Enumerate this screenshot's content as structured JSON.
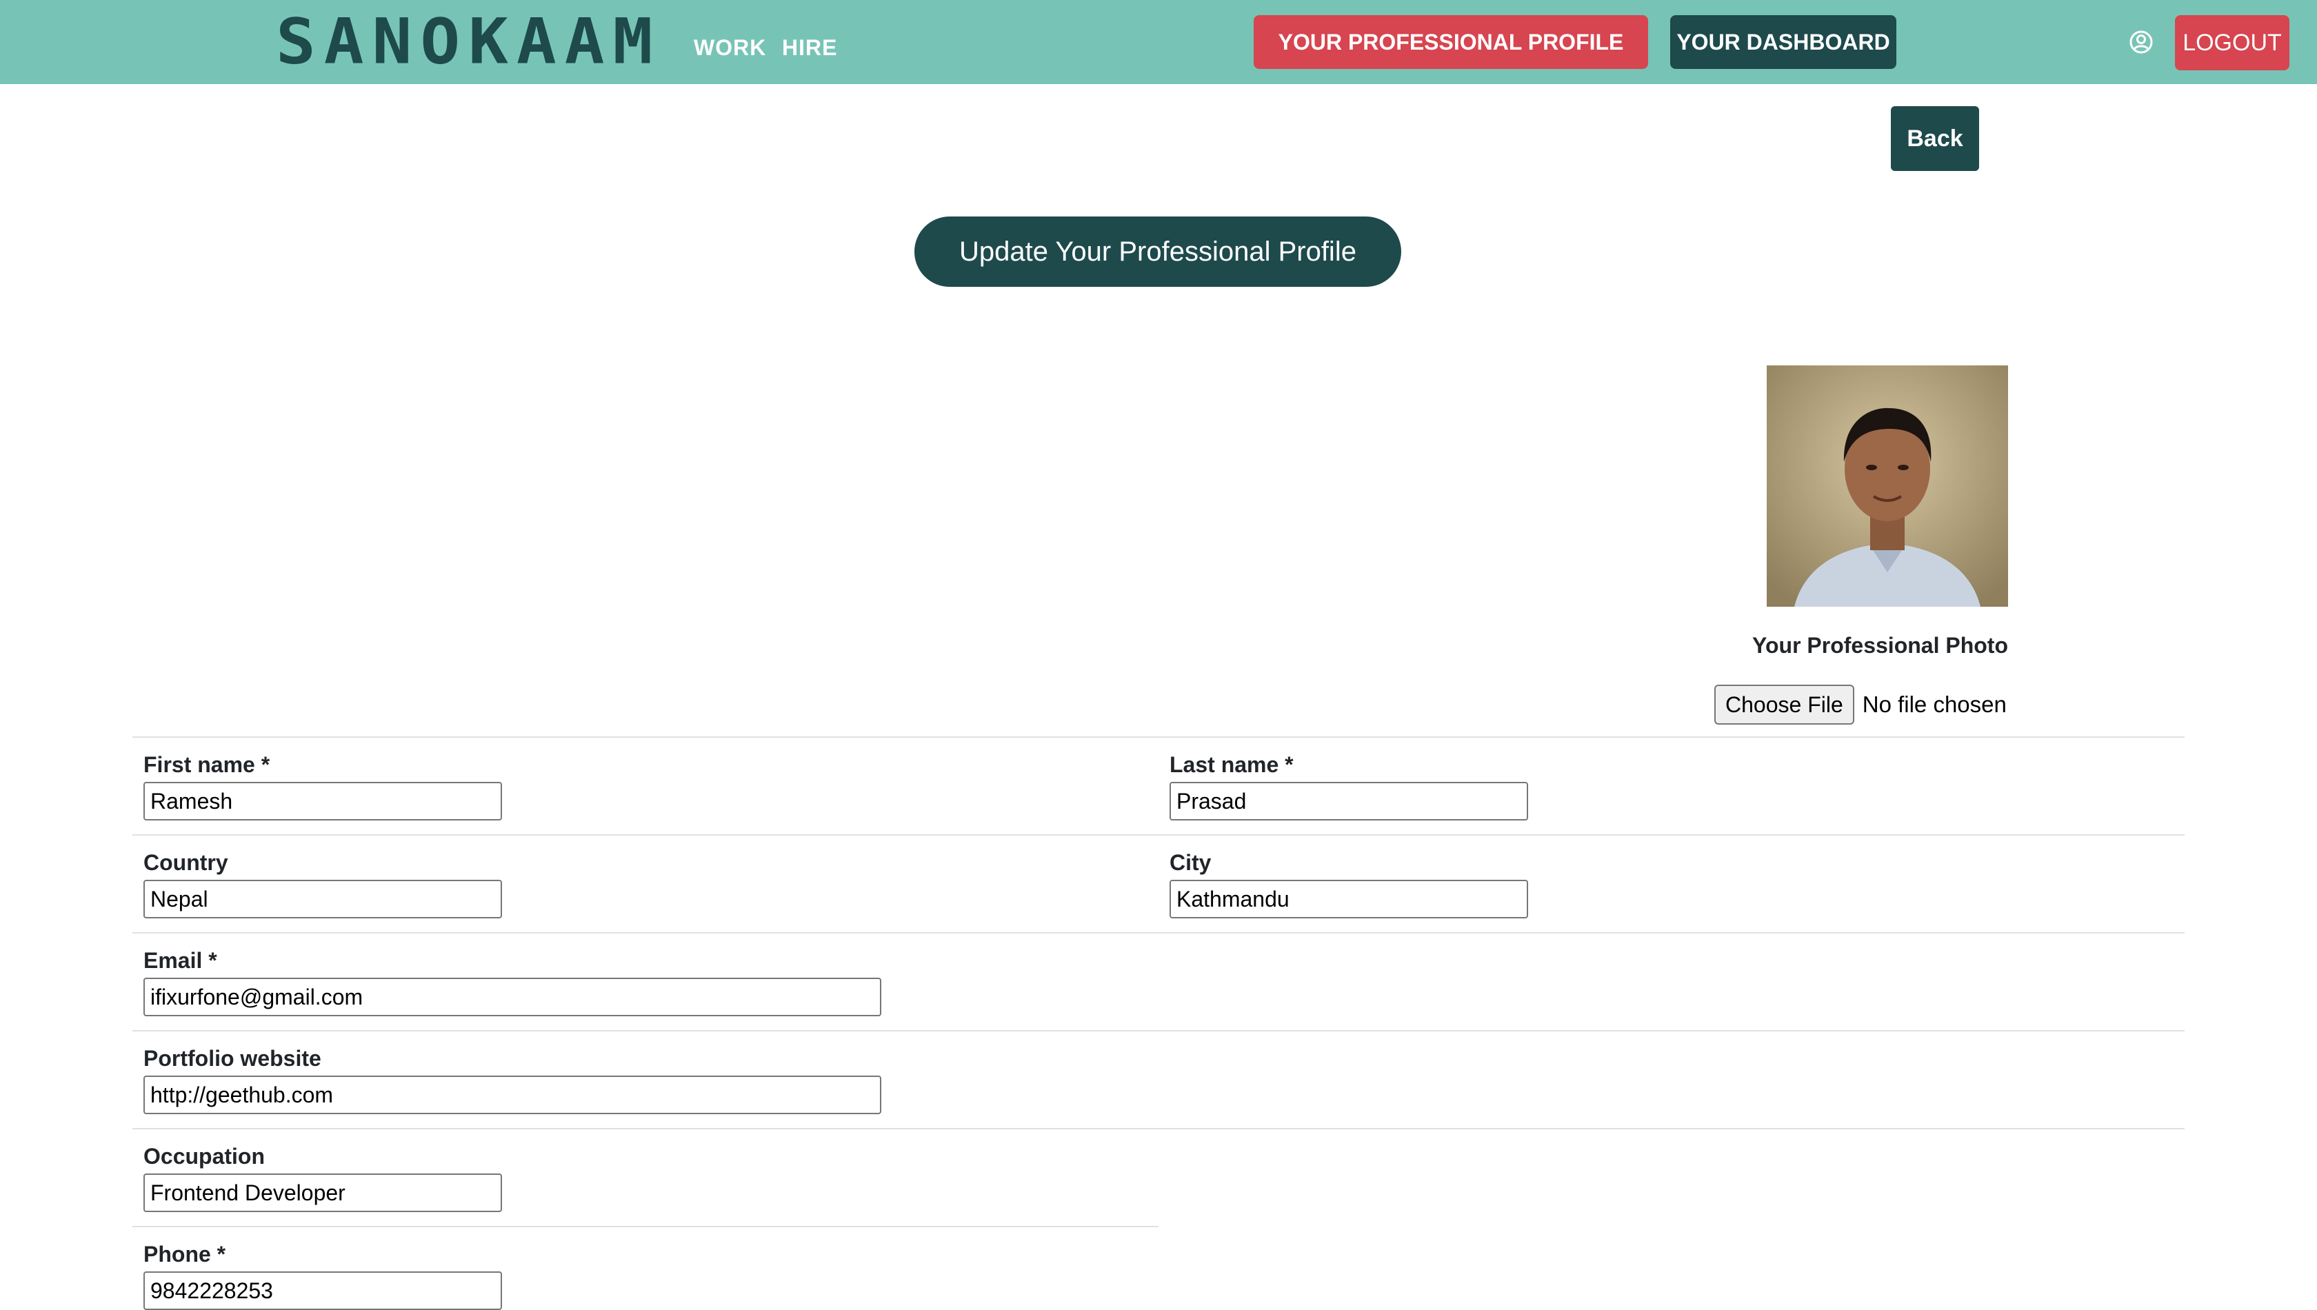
{
  "navbar": {
    "brand": "SANOKAAM",
    "links": [
      "WORK",
      "HIRE"
    ],
    "profile_button": "YOUR PROFESSIONAL PROFILE",
    "dashboard_button": "YOUR DASHBOARD",
    "logout_button": "LOGOUT",
    "user_icon": "user-circle-icon"
  },
  "page": {
    "back_button": "Back",
    "update_button": "Update Your Professional Profile"
  },
  "photo": {
    "caption": "Your Professional Photo",
    "choose_file": "Choose File",
    "file_status": "No file chosen"
  },
  "form": {
    "first_name": {
      "label": "First name *",
      "value": "Ramesh"
    },
    "last_name": {
      "label": "Last name *",
      "value": "Prasad"
    },
    "country": {
      "label": "Country",
      "value": "Nepal"
    },
    "city": {
      "label": "City",
      "value": "Kathmandu"
    },
    "email": {
      "label": "Email *",
      "value": "ifixurfone@gmail.com"
    },
    "portfolio": {
      "label": "Portfolio website",
      "value": "http://geethub.com"
    },
    "occupation": {
      "label": "Occupation",
      "value": "Frontend Developer"
    },
    "phone": {
      "label": "Phone *",
      "value": "9842228253"
    }
  },
  "colors": {
    "navbar": "#77c4b6",
    "dark_teal": "#1e4a4c",
    "red": "#d64550"
  }
}
